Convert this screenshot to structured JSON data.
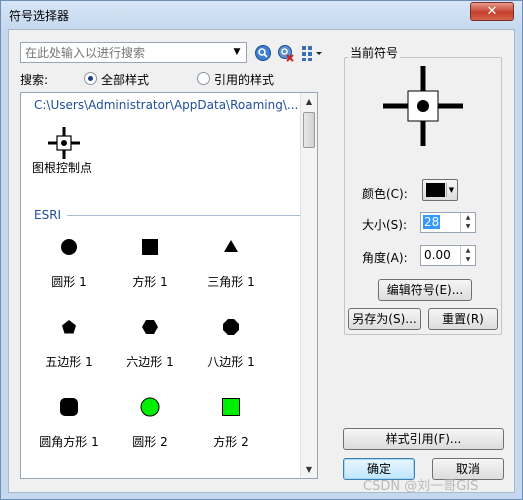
{
  "window": {
    "title": "符号选择器",
    "close_glyph": "✕"
  },
  "search": {
    "placeholder": "在此处输入以进行搜索",
    "label": "搜索:"
  },
  "toolbar": {
    "icons": [
      "search-icon",
      "clear-search-icon",
      "view-mode-icon"
    ]
  },
  "scope": {
    "all_styles": "全部样式",
    "referenced_styles": "引用的样式",
    "selected": "all_styles"
  },
  "list": {
    "path": "C:\\Users\\Administrator\\AppData\\Roaming\\...",
    "top_item": {
      "name": "图根控制点"
    },
    "group": "ESRI",
    "items": [
      {
        "name": "圆形 1",
        "shape": "circle",
        "color": "#000000"
      },
      {
        "name": "方形 1",
        "shape": "square",
        "color": "#000000"
      },
      {
        "name": "三角形 1",
        "shape": "triangle",
        "color": "#000000"
      },
      {
        "name": "五边形 1",
        "shape": "pentagon",
        "color": "#000000"
      },
      {
        "name": "六边形 1",
        "shape": "hexagon",
        "color": "#000000"
      },
      {
        "name": "八边形 1",
        "shape": "octagon",
        "color": "#000000"
      },
      {
        "name": "圆角方形 1",
        "shape": "rounded-square",
        "color": "#000000"
      },
      {
        "name": "圆形 2",
        "shape": "circle",
        "color": "#00ee00"
      },
      {
        "name": "方形 2",
        "shape": "square",
        "color": "#00ee00"
      }
    ]
  },
  "current_symbol": {
    "title": "当前符号",
    "color_label": "颜色(C):",
    "color_value": "#000000",
    "size_label": "大小(S):",
    "size_value": "28",
    "angle_label": "角度(A):",
    "angle_value": "0.00",
    "edit_button": "编辑符号(E)...",
    "save_as_button": "另存为(S)...",
    "reset_button": "重置(R)"
  },
  "style_ref_button": "样式引用(F)...",
  "ok_button": "确定",
  "cancel_button": "取消",
  "watermark": "CSDN @刘一哥GIS"
}
